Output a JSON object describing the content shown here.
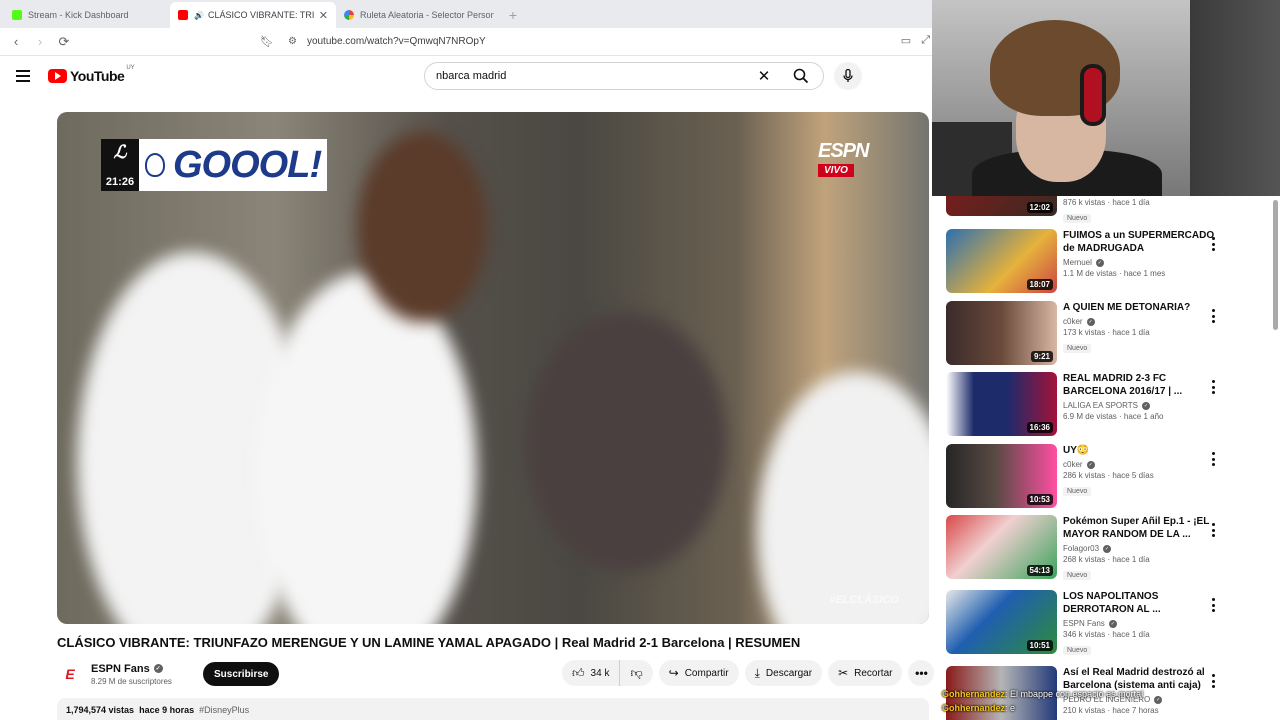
{
  "browser": {
    "tabs": [
      {
        "title": "Stream - Kick Dashboard",
        "favicon_color": "#53fc18",
        "active": false
      },
      {
        "title": "CLÁSICO VIBRANTE: TRIUNFAZO",
        "favicon_color": "#ff0000",
        "active": true
      },
      {
        "title": "Ruleta Aleatoria - Selector Personaliz",
        "favicon_color": "#ea4335",
        "active": false
      }
    ],
    "url": "youtube.com/watch?v=QmwqN7NROpY"
  },
  "youtube": {
    "logo_text": "YouTube",
    "country": "UY",
    "search_query": "nbarca madrid"
  },
  "player": {
    "scorebug_time": "21:26",
    "scorebug_goal": "GOOOL!",
    "network": "ESPN",
    "live_label": "VIVO",
    "watermark": "#ELCLÁSICO"
  },
  "video": {
    "title": "CLÁSICO VIBRANTE: TRIUNFAZO MERENGUE Y UN LAMINE YAMAL APAGADO | Real Madrid 2-1 Barcelona | RESUMEN",
    "channel": "ESPN Fans",
    "subscribers": "8.29 M de suscriptores",
    "subscribe_label": "Suscribirse",
    "likes": "34 k",
    "share_label": "Compartir",
    "download_label": "Descargar",
    "clip_label": "Recortar",
    "views": "1,794,574 vistas",
    "age": "hace 9 horas",
    "hashtag": "#DisneyPlus"
  },
  "recommendations": [
    {
      "title": "",
      "channel": "",
      "meta": "876 k vistas · hace 1 día",
      "duration": "12:02",
      "badge": "Nuevo",
      "thumb": [
        "#8a1a1a",
        "#3a2a22"
      ]
    },
    {
      "title": "FUIMOS a un SUPERMERCADO de MADRUGADA",
      "channel": "Mernuel",
      "meta": "1.1 M de vistas · hace 1 mes",
      "duration": "18:07",
      "badge": "",
      "thumb": [
        "#2d6fb0",
        "#e6b23c"
      ]
    },
    {
      "title": "A QUIEN ME DETONARIA?",
      "channel": "c0ker",
      "meta": "173 k vistas · hace 1 día",
      "duration": "9:21",
      "badge": "Nuevo",
      "thumb": [
        "#3b2b2b",
        "#d9b7a5"
      ]
    },
    {
      "title": "REAL MADRID 2-3 FC BARCELONA 2016/17 | ...",
      "channel": "LALIGA EA SPORTS",
      "meta": "6.9 M de vistas · hace 1 año",
      "duration": "16:36",
      "badge": "",
      "thumb": [
        "#1d2b6b",
        "#a3123a"
      ]
    },
    {
      "title": "UY😳",
      "channel": "c0ker",
      "meta": "286 k vistas · hace 5 días",
      "duration": "10:53",
      "badge": "Nuevo",
      "thumb": [
        "#262626",
        "#ff4fa3"
      ]
    },
    {
      "title": "Pokémon Super Añil Ep.1 - ¡EL MAYOR RANDOM DE LA ...",
      "channel": "Folagor03",
      "meta": "268 k vistas · hace 1 día",
      "duration": "54:13",
      "badge": "Nuevo",
      "thumb": [
        "#3aa35b",
        "#d94848"
      ]
    },
    {
      "title": "LOS NAPOLITANOS DERROTARON AL ...",
      "channel": "ESPN Fans",
      "meta": "346 k vistas · hace 1 día",
      "duration": "10:51",
      "badge": "Nuevo",
      "thumb": [
        "#1f5fb0",
        "#2e8c3a"
      ]
    },
    {
      "title": "Así el Real Madrid destrozó al Barcelona (sistema anti caja)",
      "channel": "PEDRO EL INGENIERO",
      "meta": "210 k vistas · hace 7 horas",
      "duration": "",
      "badge": "",
      "thumb": [
        "#8a1a1a",
        "#223a7a"
      ]
    }
  ],
  "chat": [
    {
      "user": "Gohhernandez",
      "text": ": El mbappe con espacio es mortal"
    },
    {
      "user": "Gohhernandez",
      "text": ": e"
    }
  ]
}
